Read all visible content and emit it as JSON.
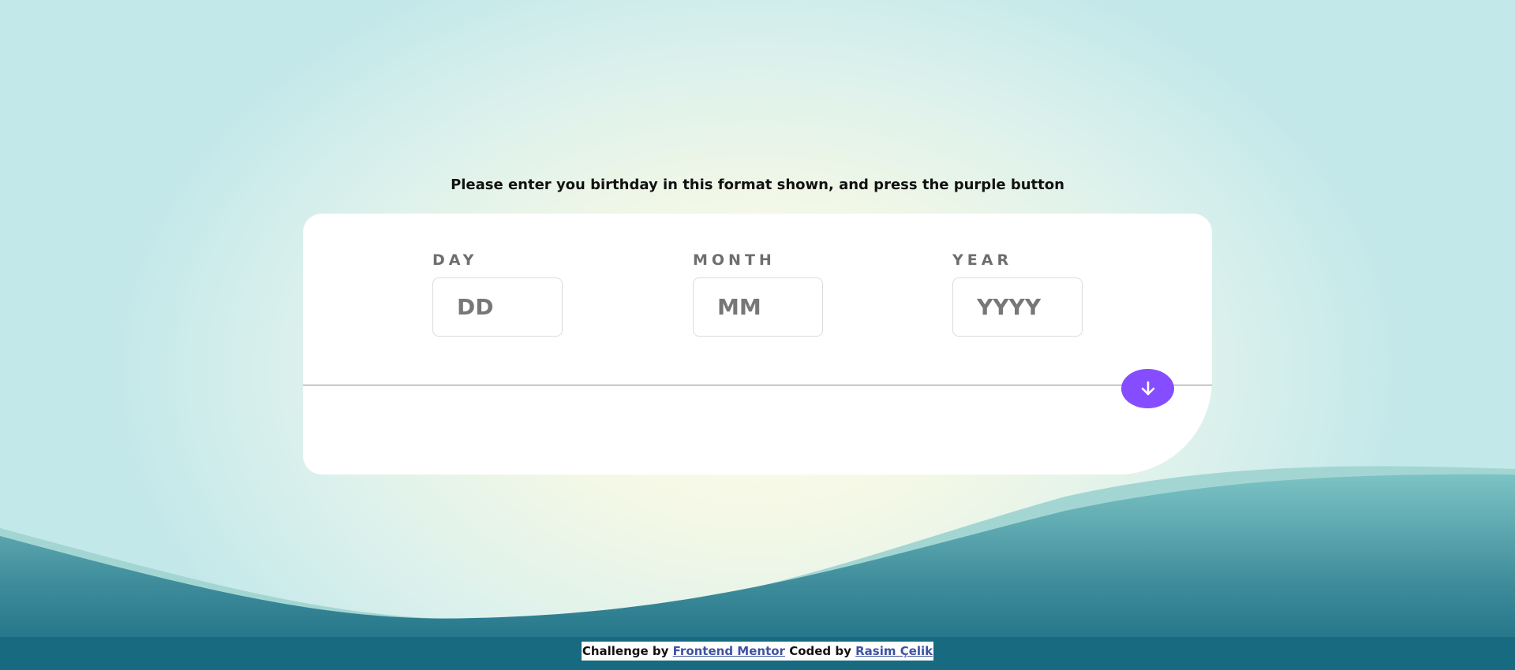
{
  "instruction": "Please enter you birthday in this format shown, and press the purple button",
  "form": {
    "day": {
      "label": "DAY",
      "placeholder": "DD",
      "value": ""
    },
    "month": {
      "label": "MONTH",
      "placeholder": "MM",
      "value": ""
    },
    "year": {
      "label": "YEAR",
      "placeholder": "YYYY",
      "value": ""
    },
    "submit_icon": "arrow-down-icon"
  },
  "footer": {
    "challenge_prefix": "Challenge by",
    "challenge_link": "Frontend Mentor",
    "coded_prefix": "Coded by",
    "coded_link": "Rasim Çelik"
  },
  "colors": {
    "accent": "#854dff",
    "wave_dark": "#176a80",
    "wave_light": "#8ccbcb",
    "card": "#ffffff"
  }
}
